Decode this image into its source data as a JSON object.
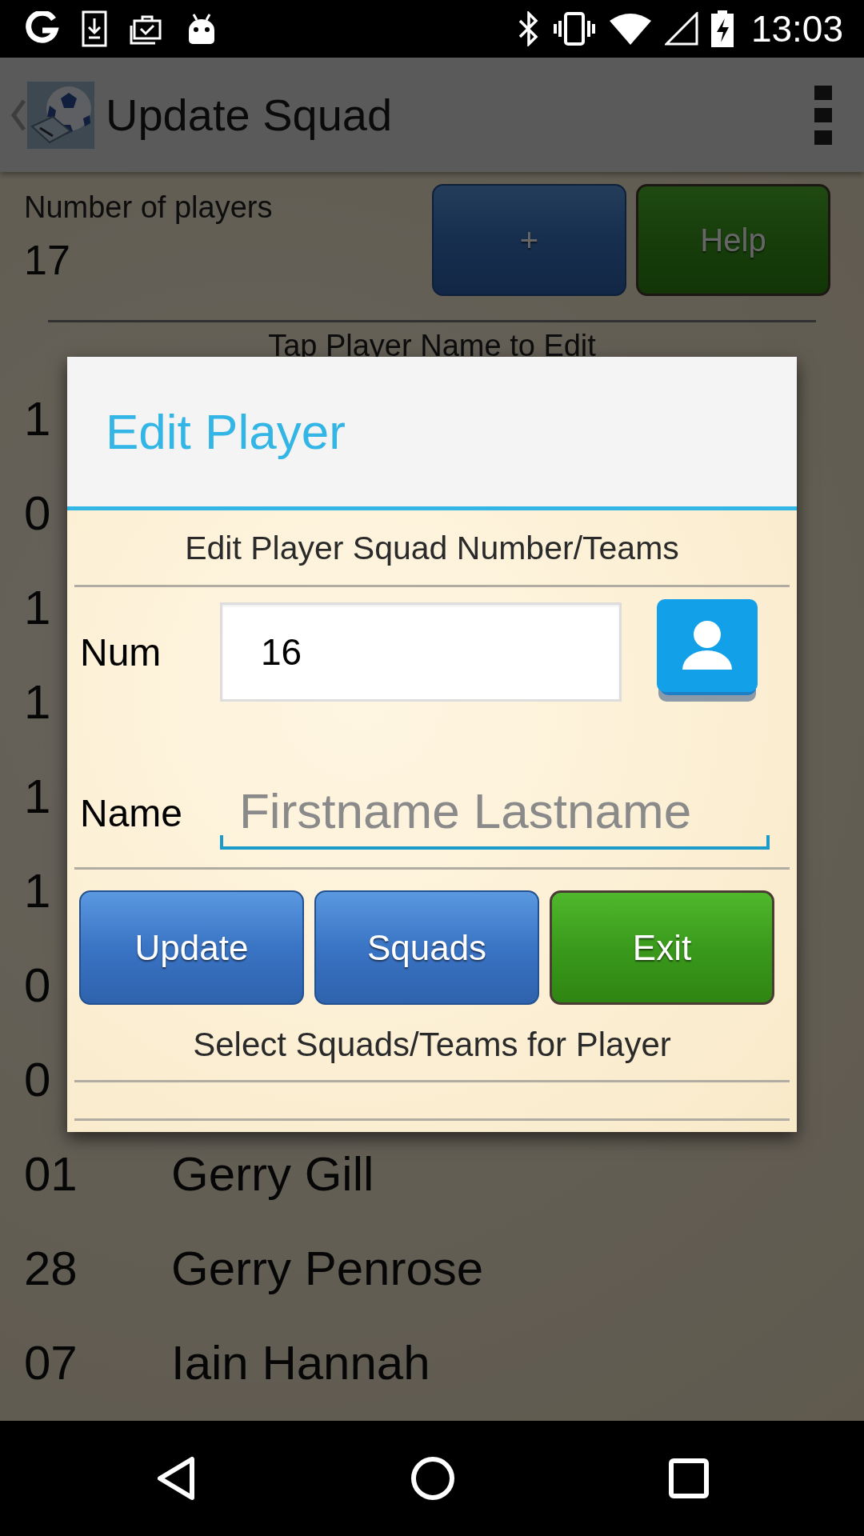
{
  "status_bar": {
    "time": "13:03"
  },
  "app_bar": {
    "title": "Update Squad"
  },
  "summary": {
    "label": "Number of players",
    "count": "17"
  },
  "top_buttons": [
    {
      "label": "+",
      "kind": "blue"
    },
    {
      "label": "Help",
      "kind": "green"
    }
  ],
  "list_hint": "Tap Player Name to Edit",
  "players": [
    {
      "number": "1"
    },
    {
      "number": "0"
    },
    {
      "number": "1"
    },
    {
      "number": "1"
    },
    {
      "number": "1"
    },
    {
      "number": "1"
    },
    {
      "number": "0"
    },
    {
      "number": "0"
    },
    {
      "number": "01",
      "name": "Gerry Gill"
    },
    {
      "number": "28",
      "name": "Gerry Penrose"
    },
    {
      "number": "07",
      "name": "Iain Hannah"
    }
  ],
  "dialog": {
    "title": "Edit Player",
    "subtitle": "Edit Player Squad Number/Teams",
    "num_label": "Num",
    "num_value": "16",
    "name_label": "Name",
    "name_placeholder": "Firstname Lastname",
    "buttons": [
      {
        "label": "Update",
        "kind": "blue"
      },
      {
        "label": "Squads",
        "kind": "blue"
      },
      {
        "label": "Exit",
        "kind": "green"
      }
    ],
    "footer": "Select Squads/Teams for Player"
  }
}
